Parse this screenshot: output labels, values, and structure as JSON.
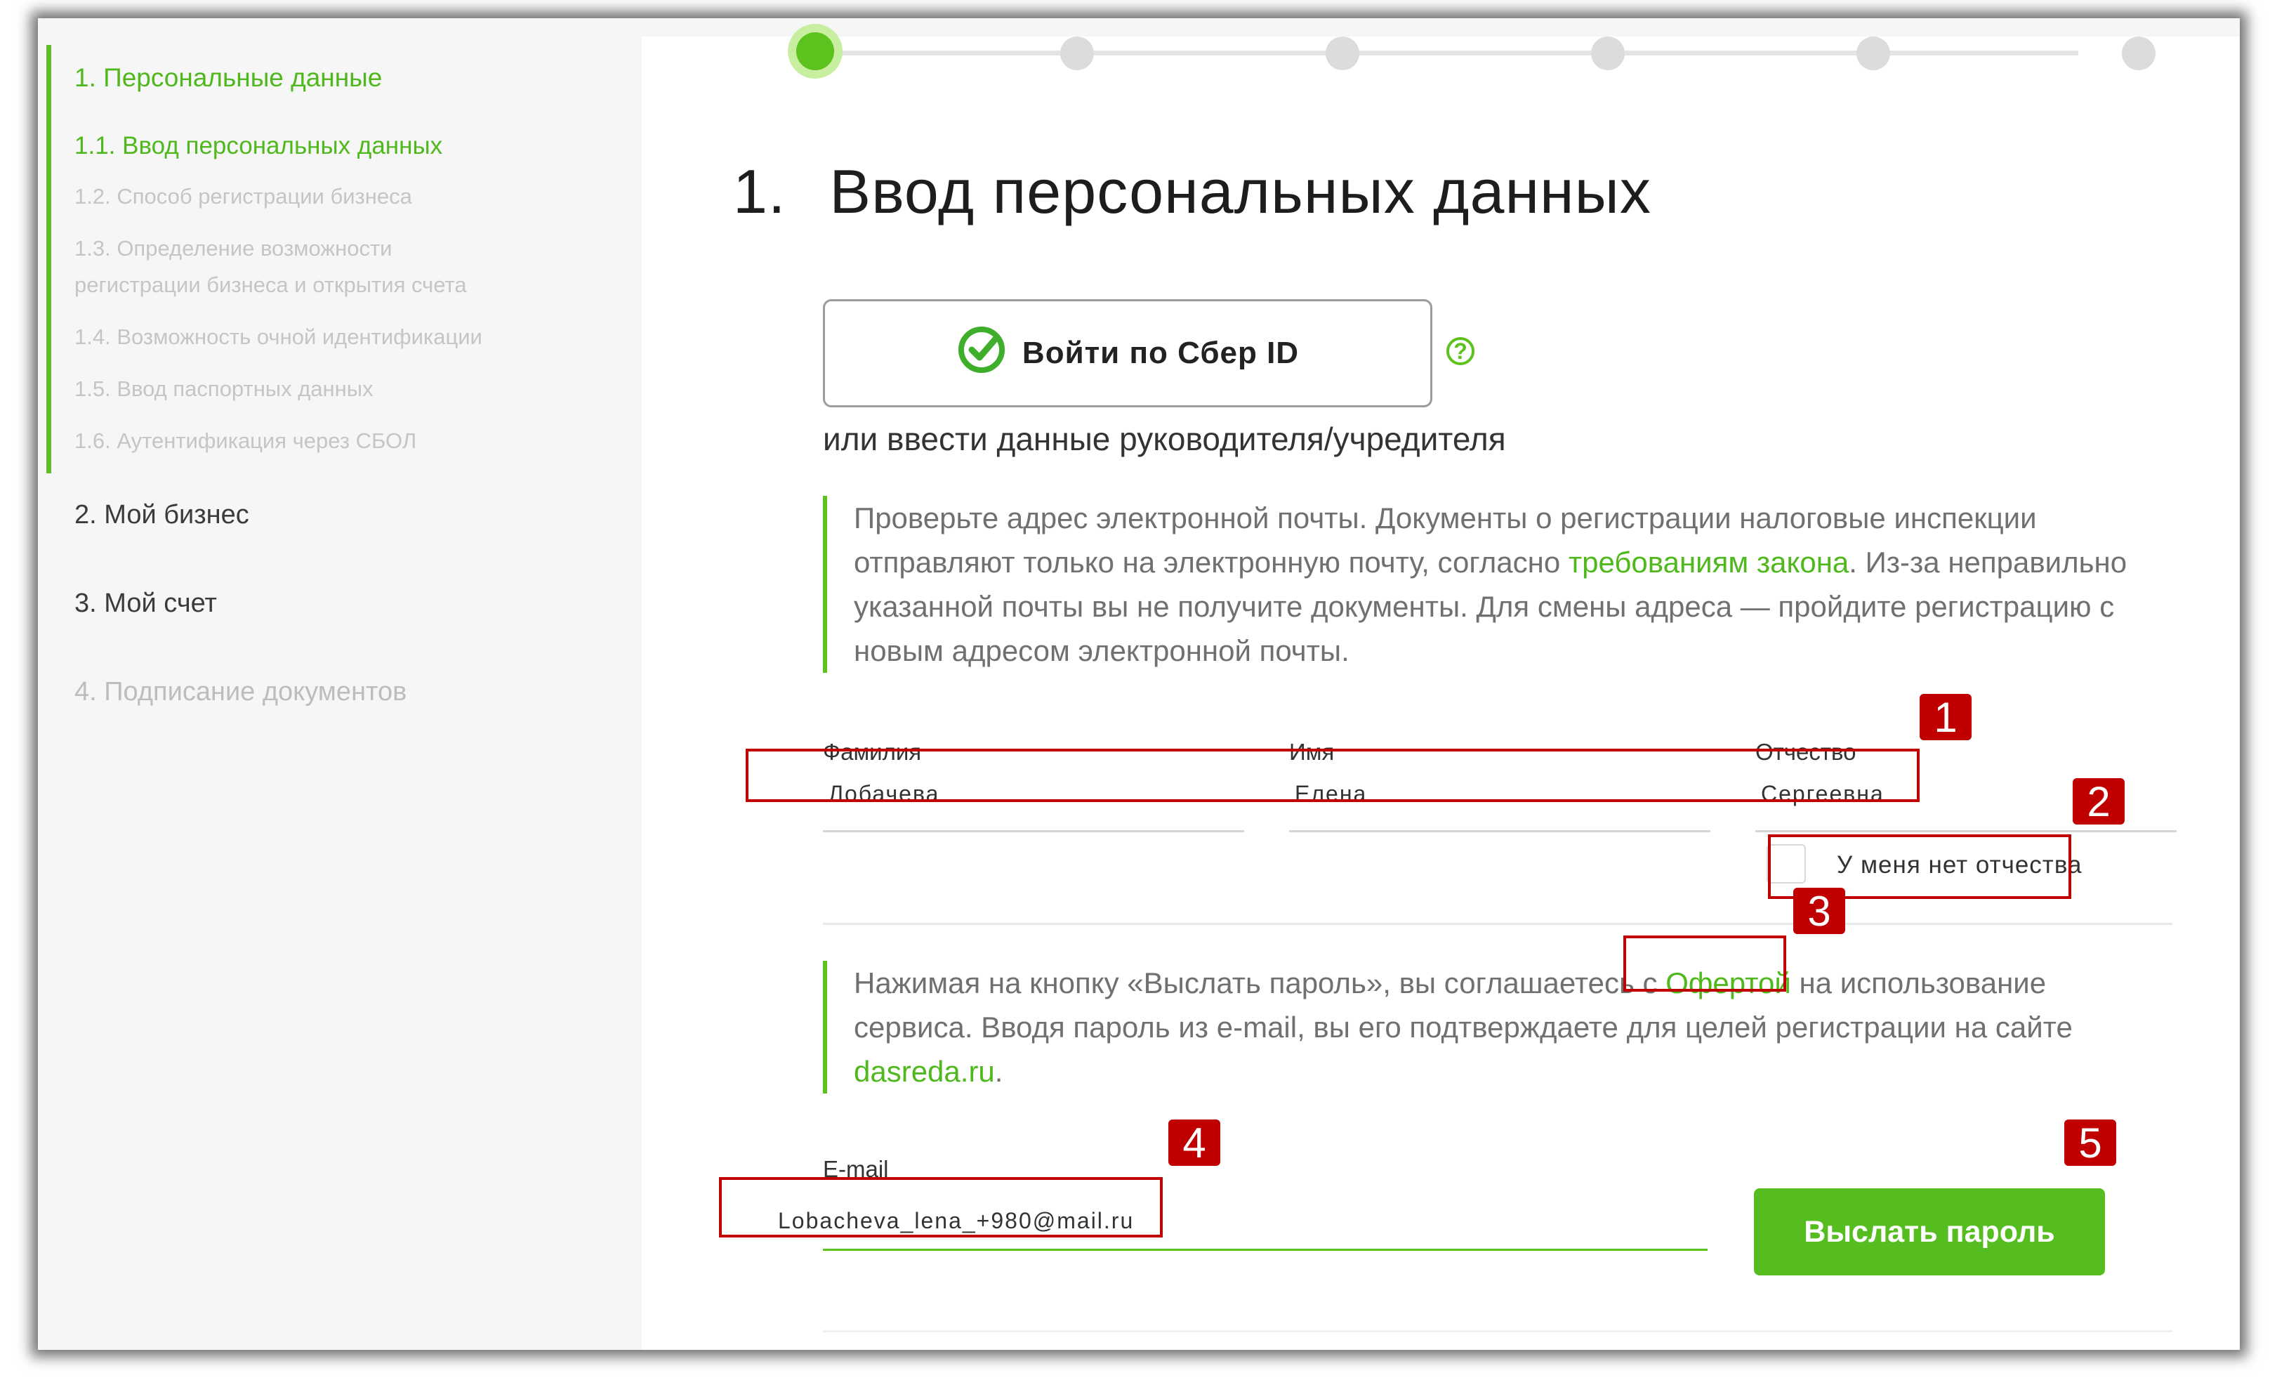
{
  "sidebar": {
    "section1": "1. Персональные данные",
    "items": [
      "1.1. Ввод персональных данных",
      "1.2. Способ регистрации бизнеса",
      "1.3. Определение возможности",
      "регистрации бизнеса и открытия счета",
      "1.4. Возможность очной идентификации",
      "1.5. Ввод паспортных данных",
      "1.6. Аутентификация через СБОЛ"
    ],
    "section2": "2. Мой бизнес",
    "section3": "3. Мой счет",
    "section4": "4. Подписание документов"
  },
  "main": {
    "title_num": "1.",
    "title": "Ввод персональных данных",
    "sber_button": "Войти по Сбер ID",
    "help_glyph": "?",
    "alt_text": "или ввести данные руководителя/учредителя",
    "notice1": {
      "p1": "Проверьте адрес электронной почты. Документы о регистрации налоговые инспекции отправляют только на электронную почту, согласно ",
      "link": "требованиям закона",
      "p2": ". Из-за неправильно указанной почты вы не получите документы. Для смены адреса — пройдите регистрацию с новым адресом электронной почты."
    },
    "fields": {
      "surname_label": "Фамилия",
      "surname_value": "Лобачева",
      "name_label": "Имя",
      "name_value": "Елена",
      "patronymic_label": "Отчество",
      "patronymic_value": "Сергеевна"
    },
    "no_patronymic": "У меня нет отчества",
    "notice2": {
      "p1": "Нажимая на кнопку «Выслать пароль», вы соглашаетесь с ",
      "link": "Офертой",
      "p2": " на использование сервиса. Вводя пароль из e-mail, вы его подтверждаете для целей регистрации на сайте ",
      "link2": "dasreda.ru",
      "p3": "."
    },
    "email_label": "E-mail",
    "email_value": "Lobacheva_lena_+980@mail.ru",
    "send_button": "Выслать пароль"
  },
  "annotations": [
    "1",
    "2",
    "3",
    "4",
    "5"
  ],
  "colors": {
    "accent": "#55bd1f",
    "annotation": "#c00000"
  }
}
